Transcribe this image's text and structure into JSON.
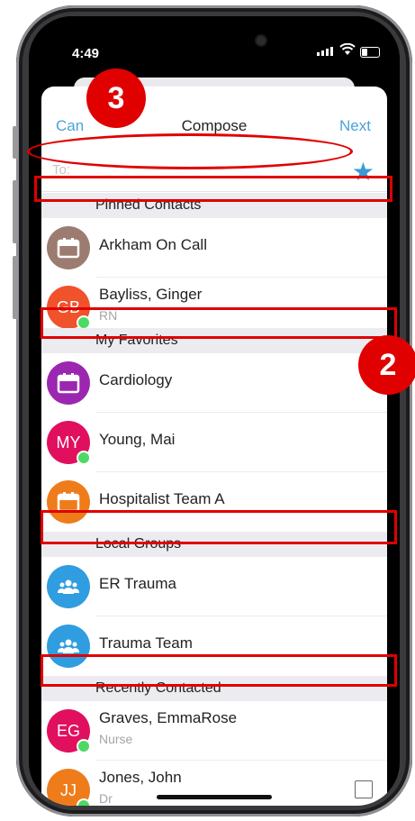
{
  "status": {
    "time": "4:49"
  },
  "nav": {
    "cancel": "Can",
    "title": "Compose",
    "next": "Next"
  },
  "to_field": {
    "placeholder": "To:"
  },
  "sections": {
    "pinned": "Pinned Contacts",
    "favorites": "My Favorites",
    "local_groups": "Local Groups",
    "recent": "Recently Contacted"
  },
  "contacts": [
    {
      "name": "Arkham On Call",
      "icon": "calendar-icon",
      "color": "#9c7c70"
    },
    {
      "name": "Bayliss, Ginger",
      "initials": "GB",
      "subtitle": "RN",
      "color": "#f0522c",
      "online": true
    },
    {
      "name": "Cardiology",
      "icon": "calendar-icon",
      "color": "#9b27b0"
    },
    {
      "name": "Young, Mai",
      "initials": "MY",
      "color": "#e0105f",
      "online": true
    },
    {
      "name": "Hospitalist Team A",
      "icon": "calendar-icon",
      "color": "#ef7c1a"
    },
    {
      "name": "ER Trauma",
      "icon": "group-icon",
      "color": "#2f9de0"
    },
    {
      "name": "Trauma Team",
      "icon": "group-icon",
      "color": "#2f9de0"
    },
    {
      "name": "Graves, EmmaRose",
      "initials": "EG",
      "subtitle": "Nurse",
      "color": "#e0105f",
      "online": true
    },
    {
      "name": "Jones, John",
      "initials": "JJ",
      "subtitle": "Dr",
      "color": "#ef7c1a",
      "online": true
    }
  ],
  "annotations": {
    "badge_3": "3",
    "badge_2": "2"
  },
  "colors": {
    "accent": "#4aa3d8",
    "annotation_red": "#e10000",
    "online": "#4cd964"
  }
}
